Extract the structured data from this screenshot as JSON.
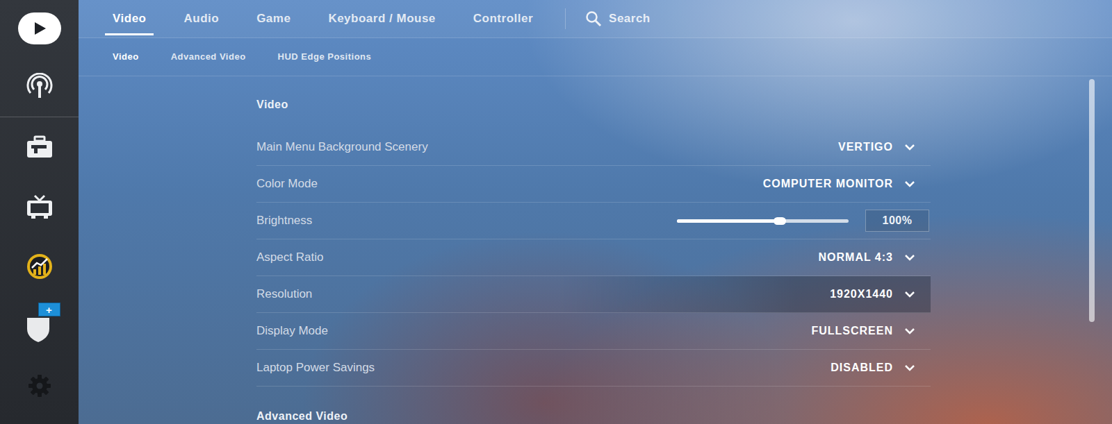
{
  "tabs": [
    {
      "label": "Video",
      "selected": true
    },
    {
      "label": "Audio",
      "selected": false
    },
    {
      "label": "Game",
      "selected": false
    },
    {
      "label": "Keyboard / Mouse",
      "selected": false
    },
    {
      "label": "Controller",
      "selected": false
    }
  ],
  "search": {
    "label": "Search"
  },
  "subtabs": [
    {
      "label": "Video",
      "selected": true
    },
    {
      "label": "Advanced Video",
      "selected": false
    },
    {
      "label": "HUD Edge Positions",
      "selected": false
    }
  ],
  "sidebar": {
    "badge": "+"
  },
  "section": {
    "title": "Video",
    "rows": [
      {
        "kind": "dropdown",
        "label": "Main Menu Background Scenery",
        "value": "VERTIGO",
        "hovered": false
      },
      {
        "kind": "dropdown",
        "label": "Color Mode",
        "value": "COMPUTER MONITOR",
        "hovered": false
      },
      {
        "kind": "slider",
        "label": "Brightness",
        "level": 0.6,
        "reading": "100%",
        "hovered": false
      },
      {
        "kind": "dropdown",
        "label": "Aspect Ratio",
        "value": "NORMAL 4:3",
        "hovered": false
      },
      {
        "kind": "dropdown",
        "label": "Resolution",
        "value": "1920X1440",
        "hovered": true
      },
      {
        "kind": "dropdown",
        "label": "Display Mode",
        "value": "FULLSCREEN",
        "hovered": false
      },
      {
        "kind": "dropdown",
        "label": "Laptop Power Savings",
        "value": "DISABLED",
        "hovered": false
      }
    ]
  },
  "next_section": {
    "title": "Advanced Video"
  }
}
